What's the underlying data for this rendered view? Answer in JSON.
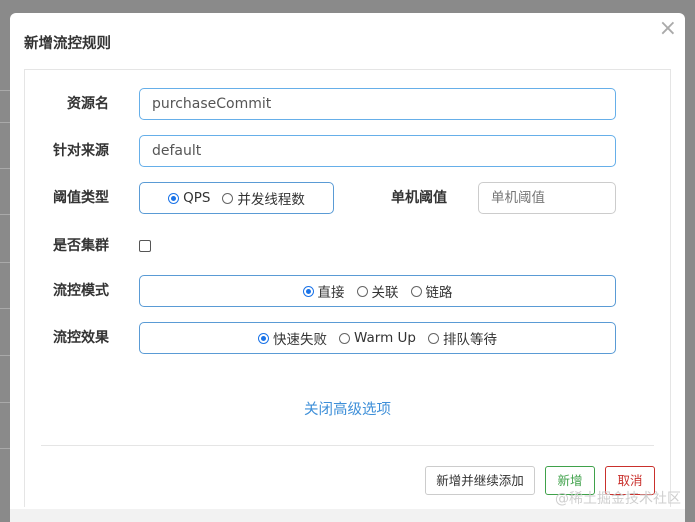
{
  "dialog": {
    "title": "新增流控规则",
    "close_icon": "×"
  },
  "form": {
    "resource": {
      "label": "资源名",
      "value": "purchaseCommit"
    },
    "source": {
      "label": "针对来源",
      "value": "default"
    },
    "threshold_type": {
      "label": "阈值类型",
      "options": [
        "QPS",
        "并发线程数"
      ],
      "selected": "QPS"
    },
    "single_threshold": {
      "label": "单机阈值",
      "placeholder": "单机阈值",
      "value": ""
    },
    "cluster": {
      "label": "是否集群",
      "checked": false
    },
    "flow_mode": {
      "label": "流控模式",
      "options": [
        "直接",
        "关联",
        "链路"
      ],
      "selected": "直接"
    },
    "flow_effect": {
      "label": "流控效果",
      "options": [
        "快速失败",
        "Warm Up",
        "排队等待"
      ],
      "selected": "快速失败"
    },
    "advanced_link": "关闭高级选项"
  },
  "footer": {
    "add_continue_label": "新增并继续添加",
    "add_label": "新增",
    "cancel_label": "取消"
  },
  "watermark": "@稀土掘金技术社区",
  "colors": {
    "accent": "#1a73e8",
    "link": "#3e8fd8",
    "success": "#3fa14a",
    "danger": "#c9302c"
  }
}
